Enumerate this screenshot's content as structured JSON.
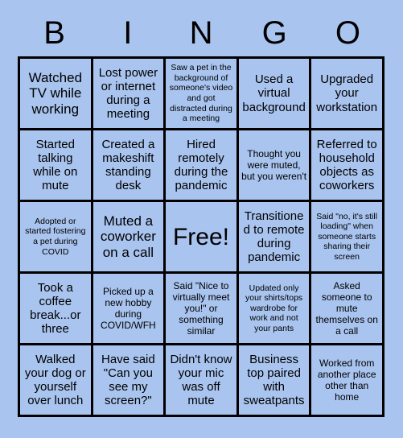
{
  "card": {
    "title_letters": [
      "B",
      "I",
      "N",
      "G",
      "O"
    ],
    "background_color": "#a9c4ef",
    "border_color": "#000000",
    "text_color": "#000000",
    "rows": 5,
    "columns": 5,
    "cells": [
      {
        "text": "Watched TV while working",
        "size": "lg",
        "free": false
      },
      {
        "text": "Lost power or internet during a meeting",
        "size": "md",
        "free": false
      },
      {
        "text": "Saw a pet in the background of someone's video and got distracted during a meeting",
        "size": "xs",
        "free": false
      },
      {
        "text": "Used a virtual background",
        "size": "md",
        "free": false
      },
      {
        "text": "Upgraded your workstation",
        "size": "md",
        "free": false
      },
      {
        "text": "Started talking while on mute",
        "size": "md",
        "free": false
      },
      {
        "text": "Created a makeshift standing desk",
        "size": "md",
        "free": false
      },
      {
        "text": "Hired remotely during the pandemic",
        "size": "md",
        "free": false
      },
      {
        "text": "Thought you were muted, but you weren't",
        "size": "sm",
        "free": false
      },
      {
        "text": "Referred to household objects as coworkers",
        "size": "md",
        "free": false
      },
      {
        "text": "Adopted or started fostering a pet during COVID",
        "size": "xs",
        "free": false
      },
      {
        "text": "Muted a coworker on a call",
        "size": "lg",
        "free": false
      },
      {
        "text": "Free!",
        "size": "xl",
        "free": true
      },
      {
        "text": "Transitioned to remote during pandemic",
        "size": "md",
        "free": false
      },
      {
        "text": "Said \"no, it's still loading\" when someone starts sharing their screen",
        "size": "xs",
        "free": false
      },
      {
        "text": "Took a coffee break...or three",
        "size": "md",
        "free": false
      },
      {
        "text": "Picked up a new hobby during COVID/WFH",
        "size": "sm",
        "free": false
      },
      {
        "text": "Said \"Nice to virtually meet you!\" or something similar",
        "size": "sm",
        "free": false
      },
      {
        "text": "Updated only your shirts/tops wardrobe for work and not your pants",
        "size": "xs",
        "free": false
      },
      {
        "text": "Asked someone to mute themselves on a call",
        "size": "sm",
        "free": false
      },
      {
        "text": "Walked your dog or yourself over lunch",
        "size": "md",
        "free": false
      },
      {
        "text": "Have said \"Can you see my screen?\"",
        "size": "md",
        "free": false
      },
      {
        "text": "Didn't know your mic was off mute",
        "size": "md",
        "free": false
      },
      {
        "text": "Business top paired with sweatpants",
        "size": "md",
        "free": false
      },
      {
        "text": "Worked from another place other than home",
        "size": "sm",
        "free": false
      }
    ]
  }
}
